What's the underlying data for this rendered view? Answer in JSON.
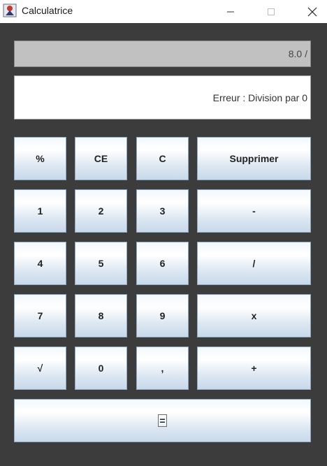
{
  "window": {
    "title": "Calculatrice"
  },
  "display": {
    "expression": "8.0 /",
    "result": "Erreur : Division par 0"
  },
  "keys": {
    "percent": "%",
    "ce": "CE",
    "c": "C",
    "delete": "Supprimer",
    "one": "1",
    "two": "2",
    "three": "3",
    "minus": "-",
    "four": "4",
    "five": "5",
    "six": "6",
    "divide": "/",
    "seven": "7",
    "eight": "8",
    "nine": "9",
    "multiply": "x",
    "sqrt": "√",
    "zero": "0",
    "comma": ",",
    "plus": "+",
    "equals": "="
  }
}
